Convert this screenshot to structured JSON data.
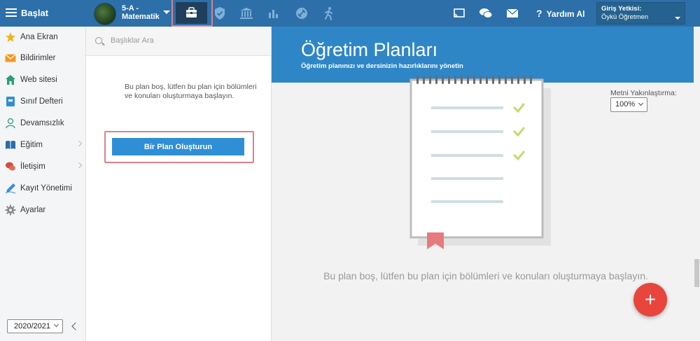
{
  "topbar": {
    "brand": "Başlat",
    "class_name": "5-A - Matematik",
    "help_label": "Yardım Al",
    "auth_label": "Giriş Yetkisi:",
    "auth_user": "Öykü Öğretmen"
  },
  "sidebar": {
    "items": [
      {
        "label": "Ana Ekran",
        "icon": "star-icon"
      },
      {
        "label": "Bildirimler",
        "icon": "envelope-icon"
      },
      {
        "label": "Web sitesi",
        "icon": "house-icon"
      },
      {
        "label": "Sınıf Defteri",
        "icon": "notebook-icon"
      },
      {
        "label": "Devamsızlık",
        "icon": "person-icon"
      },
      {
        "label": "Eğitim",
        "icon": "book-icon"
      },
      {
        "label": "İletişim",
        "icon": "chat-icon"
      },
      {
        "label": "Kayıt Yönetimi",
        "icon": "pen-icon"
      },
      {
        "label": "Ayarlar",
        "icon": "gear-icon"
      }
    ],
    "year": "2020/2021"
  },
  "planlist": {
    "search_placeholder": "Başlıklar Ara",
    "empty_message": "Bu plan boş, lütfen bu plan için bölümleri ve konuları oluşturmaya başlayın.",
    "create_button": "Bir Plan Oluşturun"
  },
  "main": {
    "title": "Öğretim Planları",
    "subtitle": "Öğretim planınızı ve dersinizin hazırlıklarını yönetin",
    "zoom_label": "Metni Yakınlaştırma:",
    "zoom_value": "100%",
    "empty_message": "Bu plan boş, lütfen bu plan için bölümleri ve konuları oluşturmaya başlayın.",
    "fab_label": "+"
  },
  "colors": {
    "topbar": "#2d6fa8",
    "banner": "#2f86c7",
    "primary_button": "#2f8fd6",
    "fab": "#e8453c",
    "highlight": "#d9828b"
  }
}
